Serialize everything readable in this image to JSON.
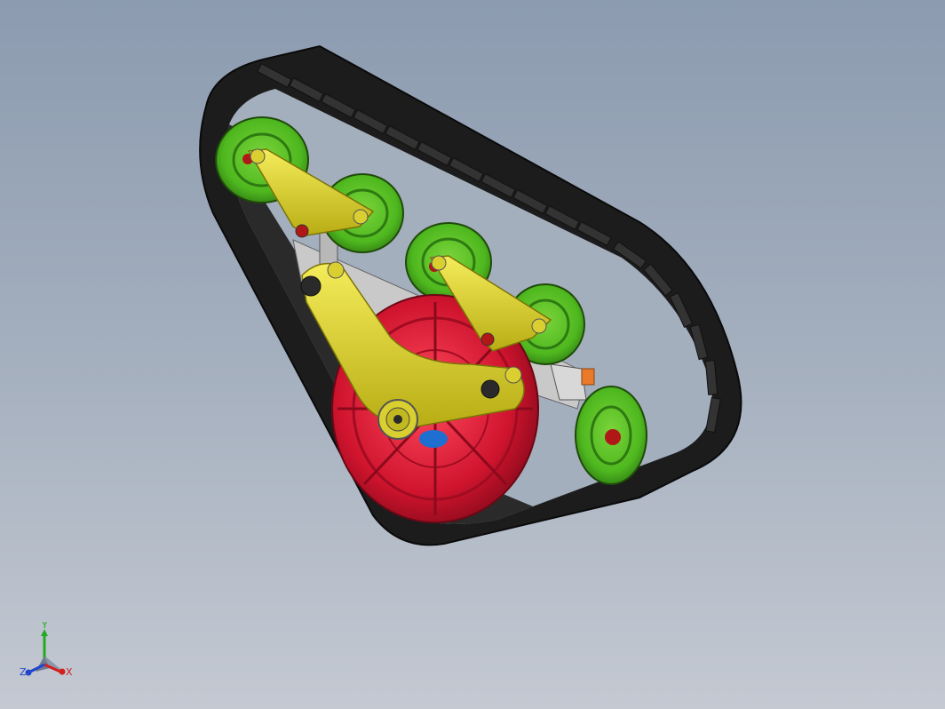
{
  "viewport": {
    "background_top": "#8c9bb0",
    "background_bottom": "#c4c9d2"
  },
  "model": {
    "track_color": "#1f1f1f",
    "track_lug_color": "#2c2c2c",
    "road_wheel_color": "#4fb81f",
    "sprocket_color": "#d0142e",
    "arm_color": "#e2d82a",
    "frame_color": "#c9c9c9",
    "pin_color": "#b01818",
    "accent_orange": "#e87a2a",
    "accent_blue": "#1e6fd0"
  },
  "triad": {
    "x_label": "X",
    "y_label": "Y",
    "z_label": "Z",
    "x_color": "#d21e1e",
    "y_color": "#22aa22",
    "z_color": "#2244cc"
  }
}
